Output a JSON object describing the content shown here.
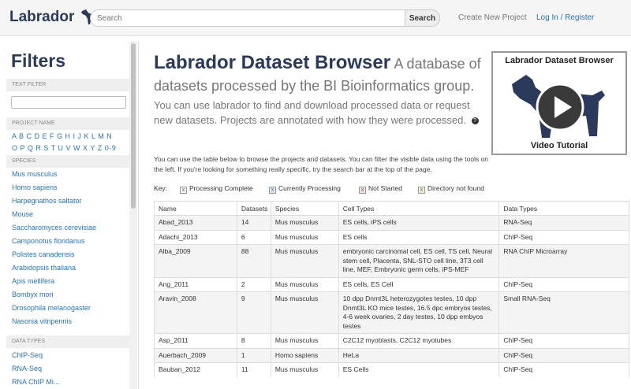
{
  "header": {
    "brand": "Labrador",
    "search_placeholder": "Search",
    "search_button": "Search",
    "create_project": "Create New Project",
    "login": "Log In / Register"
  },
  "sidebar": {
    "title": "Filters",
    "text_filter_header": "TEXT FILTER",
    "project_name_header": "PROJECT NAME",
    "letters_row1": "A B C D E F G H I J K L M N",
    "letters_row2": "O P Q R S T U V W X Y Z 0-9",
    "species_header": "SPECIES",
    "species": [
      "Mus musculus",
      "Homo sapiens",
      "Harpegnathos saltator",
      "Mouse",
      "Saccharomyces cerevisiae",
      "Camponotus floridanus",
      "Polistes canadensis",
      "Arabidopsis thaliana",
      "Apis mellifera",
      "Bombyx mori",
      "Drosophila melanogaster",
      "Nasonia vitripennis"
    ],
    "data_types_header": "DATA TYPES",
    "data_types": [
      "ChIP-Seq",
      "RNA-Seq",
      "RNA ChIP Mi..."
    ]
  },
  "main": {
    "title": "Labrador Dataset Browser",
    "subtitle": "A database of datasets processed by the BI Bioinformatics group.",
    "lead": "You can use labrador to find and download processed data or request new datasets. Projects are annotated with how they were processed.",
    "intro": "You can use the table below to browse the projects and datasets. You can filter the visible data using the tools on the left. If you're looking for something really specific, try the search bar at the top of the page.",
    "key_label": "Key:",
    "key": [
      {
        "label": "Processing Complete",
        "color": "#f4f4f4"
      },
      {
        "label": "Currently Processing",
        "color": "#dbe8f5"
      },
      {
        "label": "Not Started",
        "color": "#f5dede"
      },
      {
        "label": "Directory not found",
        "color": "#f5f0d6"
      }
    ]
  },
  "video": {
    "title": "Labrador Dataset Browser",
    "caption": "Video Tutorial"
  },
  "table": {
    "columns": [
      "Name",
      "Datasets",
      "Species",
      "Cell Types",
      "Data Types"
    ],
    "rows": [
      [
        "Abad_2013",
        "14",
        "Mus musculus",
        "ES cells, iPS cells",
        "RNA-Seq"
      ],
      [
        "Adachi_2013",
        "6",
        "Mus musculus",
        "ES cells",
        "ChIP-Seq"
      ],
      [
        "Alba_2009",
        "88",
        "Mus musculus",
        "embryonic carcinomal cell, ES cell, TS cell, Neural stem cell, Placenta, SNL-STO cell line, 3T3 cell line, MEF, Embryonic germ cells, iPS-MEF",
        "RNA ChIP Microarray"
      ],
      [
        "Ang_2011",
        "2",
        "Mus musculus",
        "ES cells, ES Cell",
        "ChIP-Seq"
      ],
      [
        "Aravin_2008",
        "9",
        "Mus musculus",
        "10 dpp Dnmt3L heterozygotes testes, 10 dpp Dnmt3L KO mice testes, 16.5 dpc embryos testes, 4-6 week ovaries, 2 day testes, 10 dpp embyos testes",
        "Small RNA-Seq"
      ],
      [
        "Asp_2011",
        "8",
        "Mus musculus",
        "C2C12 myoblasts, C2C12 myotubes",
        "ChIP-Seq"
      ],
      [
        "Auerbach_2009",
        "1",
        "Homo sapiens",
        "HeLa",
        "ChIP-Seq"
      ],
      [
        "Bauban_2012",
        "11",
        "Mus musculus",
        "ES Cells",
        "ChIP-Seq"
      ]
    ]
  }
}
